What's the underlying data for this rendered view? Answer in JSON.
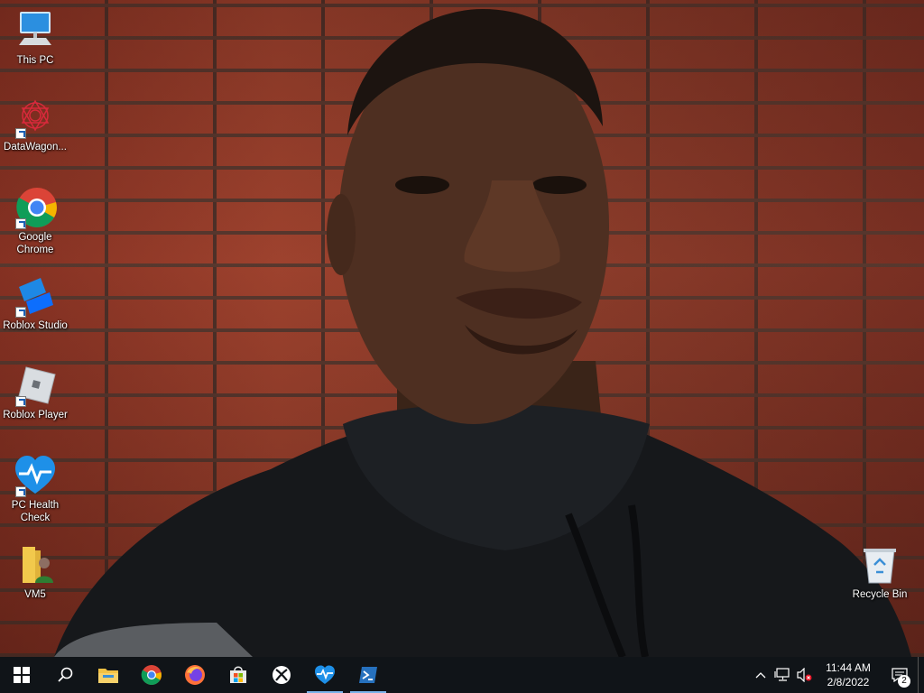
{
  "desktop": {
    "icons": [
      {
        "label": "This PC",
        "icon": "this-pc-icon"
      },
      {
        "label": "DataWagon...",
        "icon": "datawagon-icon"
      },
      {
        "label": "Google Chrome",
        "icon": "chrome-icon"
      },
      {
        "label": "Roblox Studio",
        "icon": "roblox-studio-icon"
      },
      {
        "label": "Roblox Player",
        "icon": "roblox-player-icon"
      },
      {
        "label": "PC Health Check",
        "icon": "pc-health-check-icon"
      },
      {
        "label": "VM5",
        "icon": "vm5-folder-icon"
      },
      {
        "label": "Recycle Bin",
        "icon": "recycle-bin-icon"
      }
    ]
  },
  "taskbar": {
    "apps": [
      {
        "name": "start",
        "icon": "windows-icon"
      },
      {
        "name": "search",
        "icon": "search-icon"
      },
      {
        "name": "file-explorer",
        "icon": "folder-icon"
      },
      {
        "name": "chrome",
        "icon": "chrome-icon"
      },
      {
        "name": "firefox",
        "icon": "firefox-icon"
      },
      {
        "name": "microsoft-store",
        "icon": "store-icon"
      },
      {
        "name": "xbox",
        "icon": "xbox-icon"
      },
      {
        "name": "pc-health-check",
        "icon": "heart-pulse-icon"
      },
      {
        "name": "powershell",
        "icon": "powershell-icon"
      }
    ],
    "clock": {
      "time": "11:44 AM",
      "date": "2/8/2022"
    },
    "notifications": {
      "count": "2"
    }
  }
}
